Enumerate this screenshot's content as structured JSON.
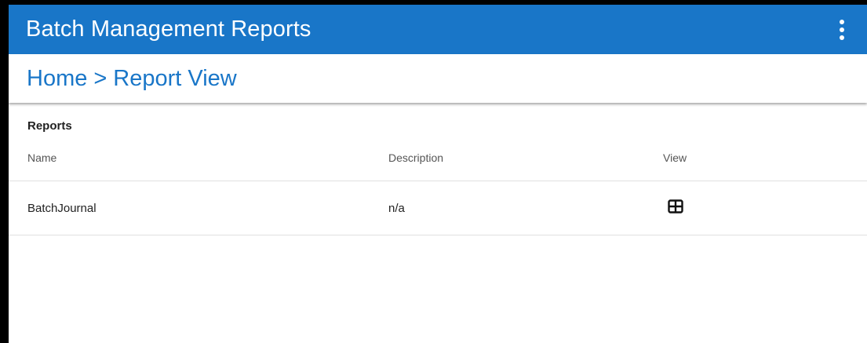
{
  "app": {
    "title": "Batch Management Reports",
    "menu_icon": "more-vert-icon",
    "accent_color": "#1976c8"
  },
  "breadcrumb": {
    "home": "Home",
    "separator": ">",
    "current": "Report View"
  },
  "reports": {
    "section_title": "Reports",
    "columns": [
      "Name",
      "Description",
      "View"
    ],
    "rows": [
      {
        "name": "BatchJournal",
        "description": "n/a",
        "view_icon": "table-view-icon"
      }
    ]
  }
}
